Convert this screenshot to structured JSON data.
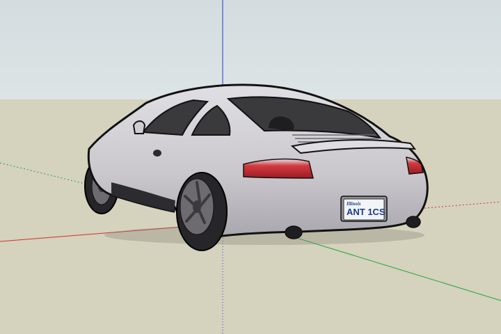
{
  "scene": {
    "sky_color": "#dde4e6",
    "sky_top_color": "#d3dcdf",
    "ground_color": "#d5d2be",
    "axis_colors": {
      "red": "#d0302a",
      "green": "#20a83a",
      "blue": "#2a3ad0"
    }
  },
  "car": {
    "body_color": "#cfcdd1",
    "shadow_color": "#8f8d95",
    "glass_color": "#3a3a3c",
    "taillight_color": "#c8262c",
    "license_plate": {
      "state": "Illinois",
      "number": "ANT 1CS",
      "plate_color": "#f2f4f8",
      "text_color": "#1c3a8c"
    }
  }
}
